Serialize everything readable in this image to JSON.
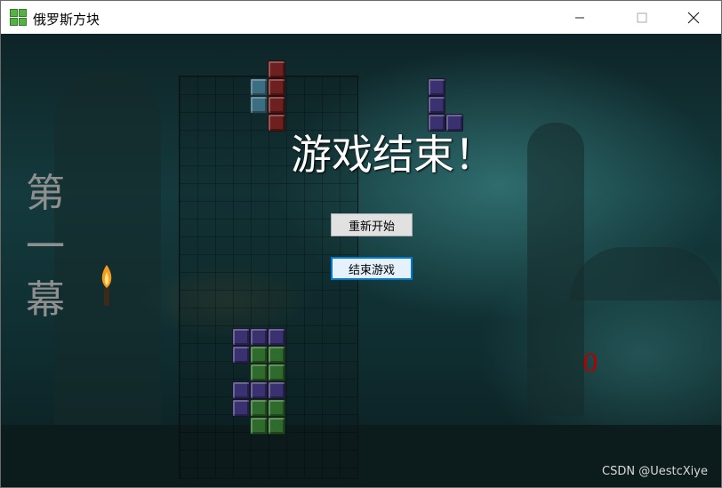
{
  "window": {
    "title": "俄罗斯方块",
    "minimize_icon": "minimize-icon",
    "maximize_icon": "maximize-icon",
    "close_icon": "close-icon"
  },
  "game": {
    "stage_chars": [
      "第",
      "一",
      "幕"
    ],
    "game_over_text": "游戏结束！",
    "restart_label": "重新开始",
    "exit_label": "结束游戏",
    "score": "0",
    "colors": {
      "red_block": "#6e1f1f",
      "teal_block": "#3c6e82",
      "purple_block": "#3a3270",
      "green_block": "#2f6b2c",
      "score_color": "#b50000"
    }
  },
  "watermark": "CSDN @UestcXiye"
}
